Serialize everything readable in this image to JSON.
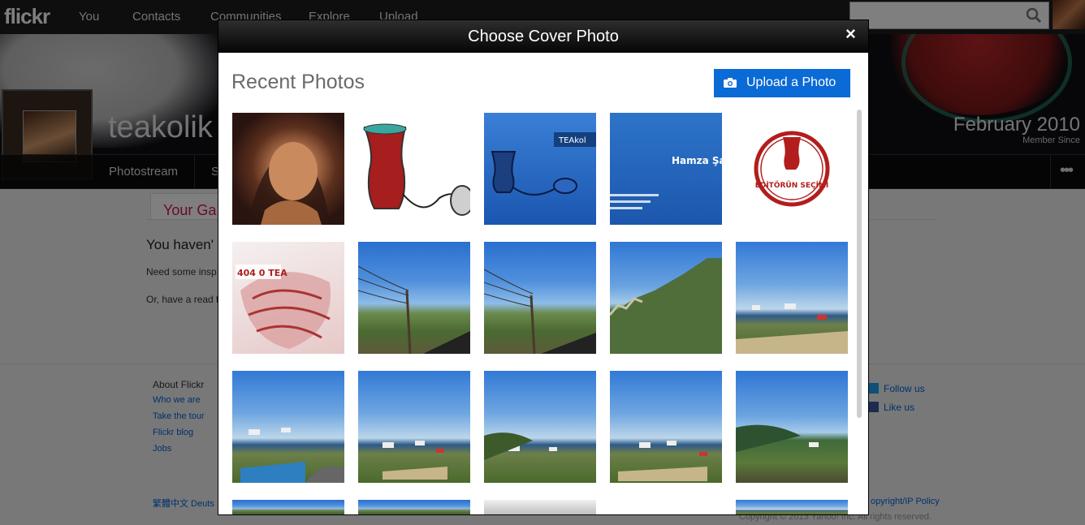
{
  "brand": {
    "logo": "flickr"
  },
  "topnav": {
    "items": [
      "You",
      "Contacts",
      "Communities",
      "Explore",
      "Upload"
    ],
    "search_placeholder": "",
    "search_icon": "search-icon"
  },
  "profile": {
    "username": "teakolik",
    "member_since_date": "February 2010",
    "member_since_label": "Member Since",
    "subnav_items": [
      "Photostream",
      "S"
    ],
    "more_label": "•••"
  },
  "background_page": {
    "gallery_tab": "Your Ga",
    "message": "You haven'",
    "line2": "Need some insp",
    "line3": "Or, have a read t"
  },
  "footer": {
    "heading": "About Flickr",
    "links": [
      "Who we are",
      "Take the tour",
      "Flickr blog",
      "Jobs"
    ],
    "social": [
      {
        "label": "Follow us",
        "color": "#1da1f2"
      },
      {
        "label": "Like us",
        "color": "#3b5998"
      }
    ],
    "languages": "繁體中文    Deuts",
    "policy": "opyright/IP Policy",
    "copyright": "Copyright © 2013 Yahoo! Inc. All rights reserved."
  },
  "modal": {
    "title": "Choose Cover Photo",
    "close_label": "×",
    "section_title": "Recent Photos",
    "upload_label": "Upload a Photo",
    "photos": [
      {
        "name": "portrait-photo",
        "style": "face"
      },
      {
        "name": "tea-glass-mouse-drawing",
        "style": "tea"
      },
      {
        "name": "teakolik-blue-card",
        "style": "blue",
        "text": "TEAkol"
      },
      {
        "name": "hamza-business-card",
        "style": "card",
        "text": "Hamza Şar"
      },
      {
        "name": "editorun-secimi-stamp",
        "style": "stamp",
        "text": "EDİTÖRÜN SEÇİMİ"
      },
      {
        "name": "404-tea-image",
        "style": "404",
        "text": "404 0 TEA"
      },
      {
        "name": "landscape-power-lines-1",
        "style": "sky1"
      },
      {
        "name": "landscape-power-lines-2",
        "style": "sky1"
      },
      {
        "name": "landscape-mountain",
        "style": "sky2"
      },
      {
        "name": "landscape-town-sea-1",
        "style": "sky3"
      },
      {
        "name": "landscape-town-sea-2",
        "style": "sky3"
      },
      {
        "name": "landscape-town-sea-3",
        "style": "sky3"
      },
      {
        "name": "landscape-town-sea-4",
        "style": "sky3"
      },
      {
        "name": "landscape-town-sea-5",
        "style": "sky3"
      },
      {
        "name": "landscape-hill-sea",
        "style": "sky2"
      },
      {
        "name": "landscape-partial-1",
        "style": "sky1"
      },
      {
        "name": "landscape-partial-2",
        "style": "sky1"
      },
      {
        "name": "interior-partial",
        "style": "interior"
      },
      {
        "name": "landscape-partial-3",
        "style": "sky3"
      }
    ]
  },
  "colors": {
    "accent_blue": "#0a6ad6",
    "brand_pink": "#d4145a"
  }
}
